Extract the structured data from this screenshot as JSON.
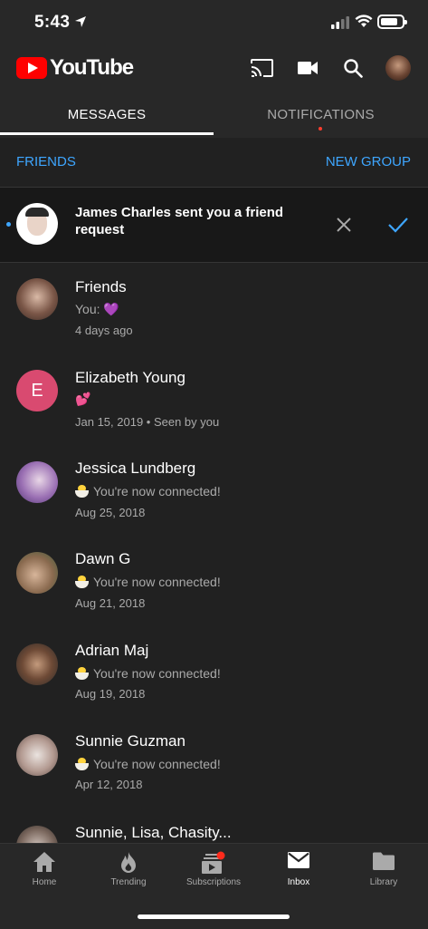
{
  "status_bar": {
    "time": "5:43"
  },
  "app_bar": {
    "brand": "YouTube"
  },
  "tabs": [
    {
      "label": "MESSAGES",
      "active": true
    },
    {
      "label": "NOTIFICATIONS",
      "active": false
    }
  ],
  "subbar": {
    "friends_label": "FRIENDS",
    "new_group_label": "NEW GROUP"
  },
  "friend_request": {
    "text": "James Charles sent you a friend request"
  },
  "conversations": [
    {
      "name": "Friends",
      "preview": "You: 💜",
      "date": "4 days ago"
    },
    {
      "name": "Elizabeth Young",
      "initial": "E",
      "preview": "💕",
      "date": "Jan 15, 2019 • Seen by you"
    },
    {
      "name": "Jessica Lundberg",
      "preview": "You're now connected!",
      "date": "Aug 25, 2018"
    },
    {
      "name": "Dawn G",
      "preview": "You're now connected!",
      "date": "Aug 21, 2018"
    },
    {
      "name": "Adrian Maj",
      "preview": "You're now connected!",
      "date": "Aug 19, 2018"
    },
    {
      "name": "Sunnie Guzman",
      "preview": "You're now connected!",
      "date": "Apr 12, 2018"
    },
    {
      "name": "Sunnie, Lisa, Chasity..."
    }
  ],
  "bottom_nav": [
    {
      "label": "Home",
      "icon": "home-icon"
    },
    {
      "label": "Trending",
      "icon": "flame-icon"
    },
    {
      "label": "Subscriptions",
      "icon": "subscriptions-icon"
    },
    {
      "label": "Inbox",
      "icon": "inbox-icon",
      "active": true
    },
    {
      "label": "Library",
      "icon": "folder-icon"
    }
  ],
  "colors": {
    "accent": "#3ea6ff",
    "brand_red": "#ff0000",
    "background": "#212121"
  }
}
